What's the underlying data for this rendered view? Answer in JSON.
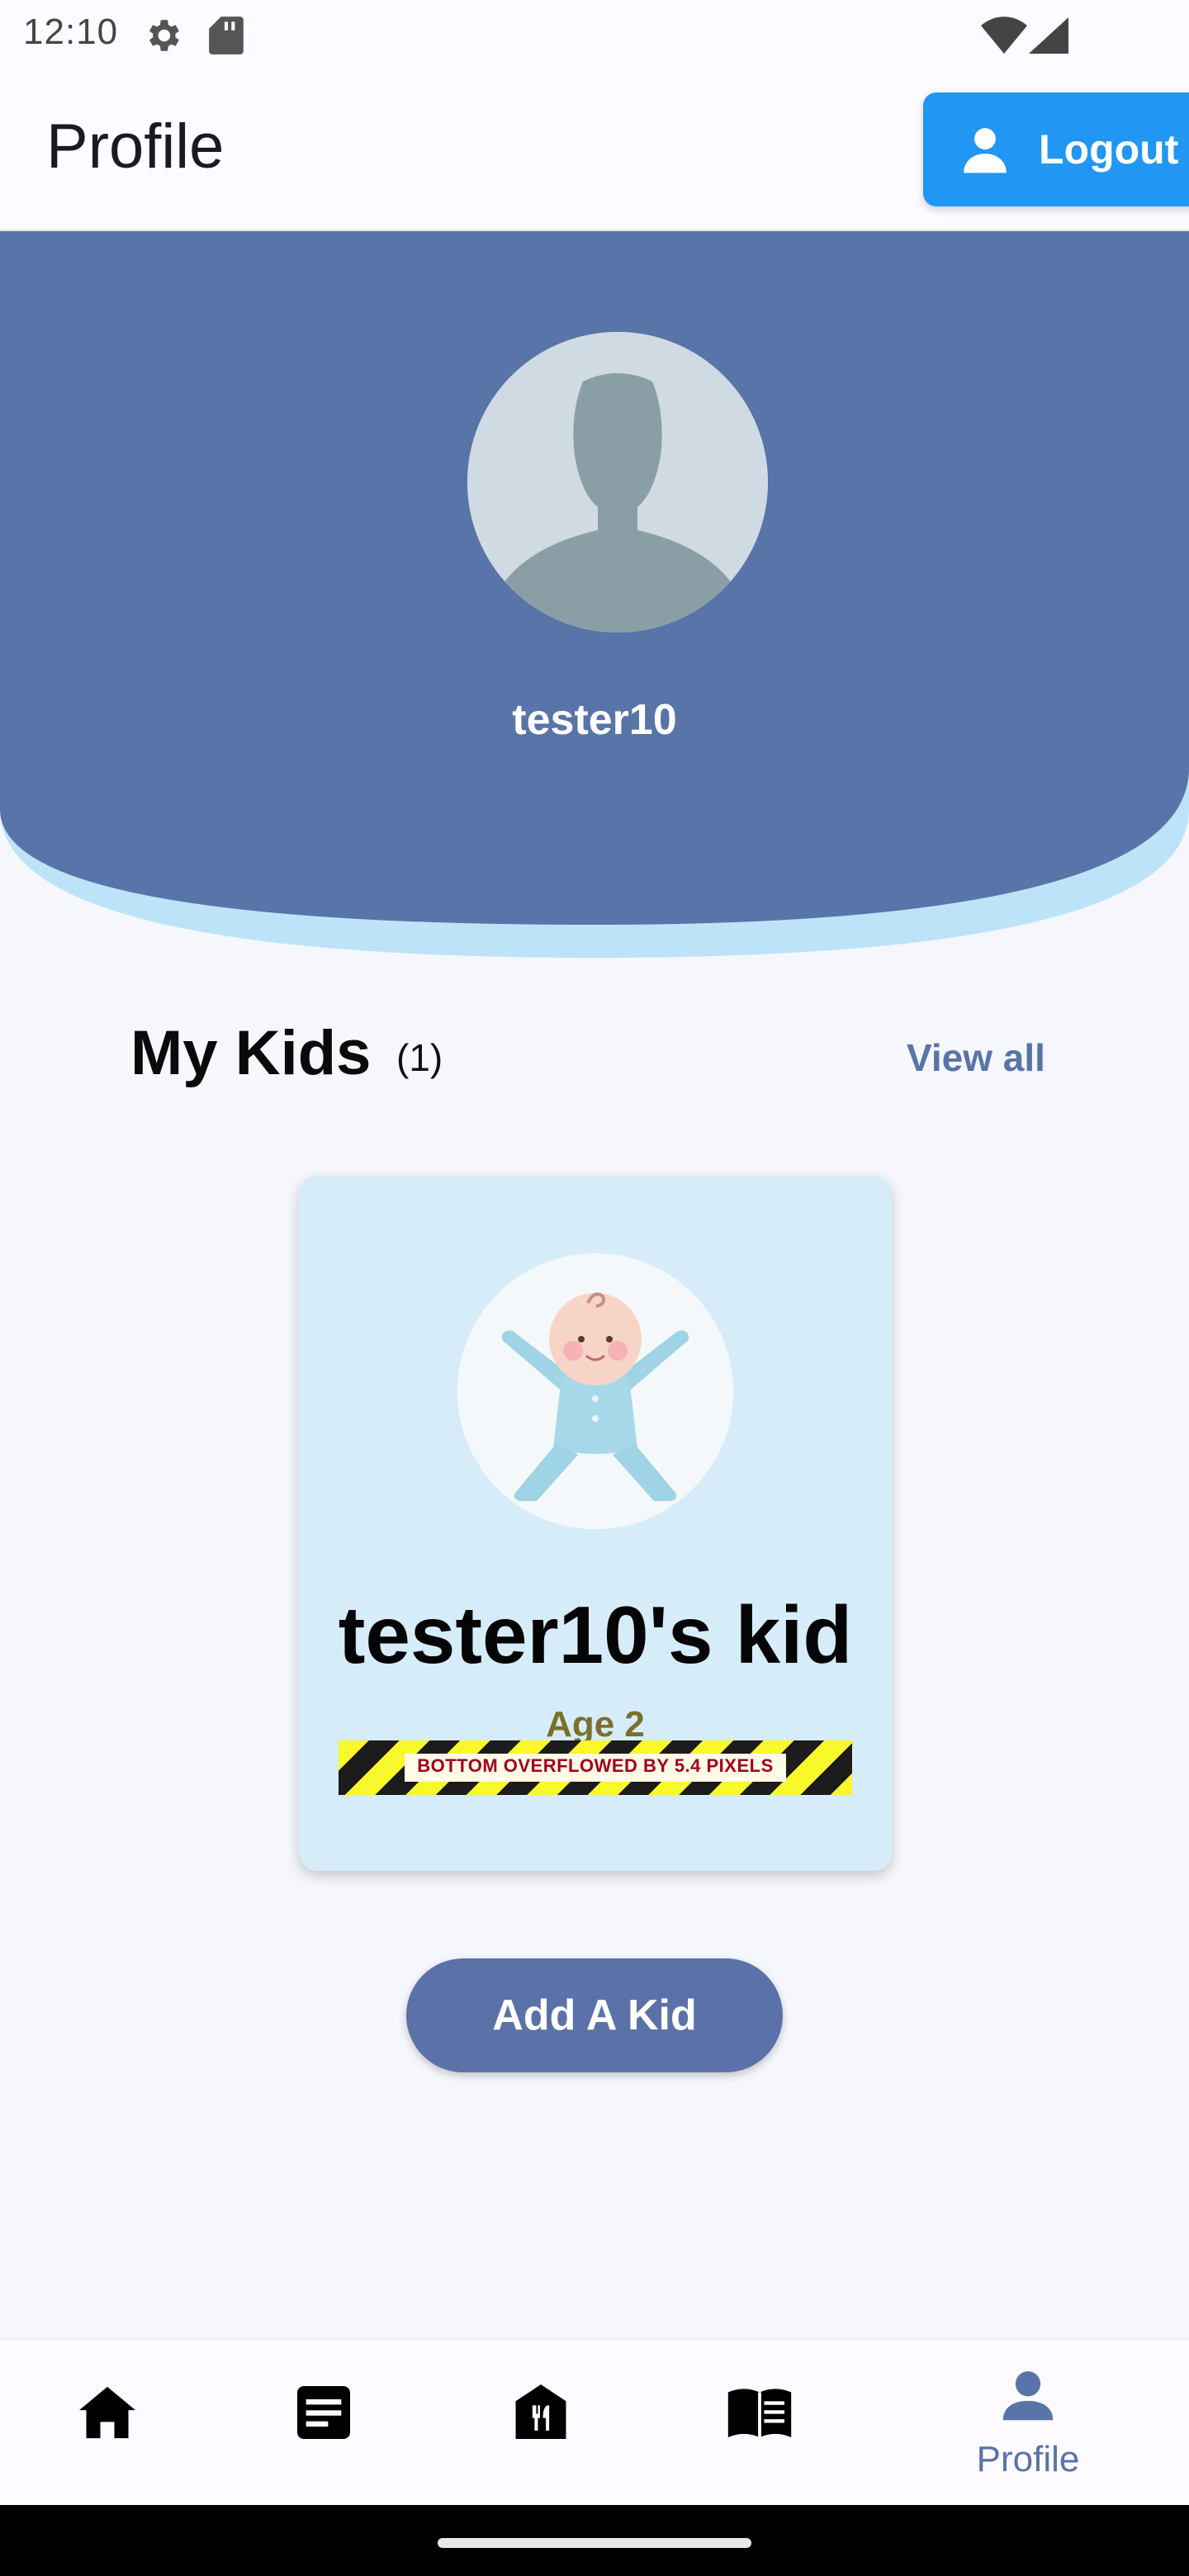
{
  "status_bar": {
    "time": "12:10",
    "icons": [
      "settings-icon",
      "sd-card-icon",
      "wifi-icon",
      "cell-signal-icon"
    ]
  },
  "app_bar": {
    "title": "Profile",
    "logout_label": "Logout",
    "logout_icon": "person-icon",
    "logout_color": "#2196f3"
  },
  "header": {
    "username": "tester10",
    "avatar_icon": "default-avatar-icon",
    "band_color": "#5874a8",
    "wave_color": "#bde3f8"
  },
  "kids_section": {
    "title": "My Kids",
    "count": "(1)",
    "view_all_label": "View all",
    "kids": [
      {
        "name": "tester10's kid",
        "age": "Age 2",
        "photo_icon": "baby-icon",
        "overflow_warning": "BOTTOM OVERFLOWED BY 5.4 PIXELS"
      }
    ],
    "add_kid_label": "Add A Kid",
    "accent_color": "#5a72a8"
  },
  "bottom_nav": {
    "items": [
      {
        "icon": "home-icon",
        "label": ""
      },
      {
        "icon": "article-icon",
        "label": ""
      },
      {
        "icon": "restaurant-icon",
        "label": ""
      },
      {
        "icon": "book-icon",
        "label": ""
      },
      {
        "icon": "person-icon",
        "label": "Profile"
      }
    ],
    "active_index": 4,
    "active_color": "#5874a8"
  }
}
